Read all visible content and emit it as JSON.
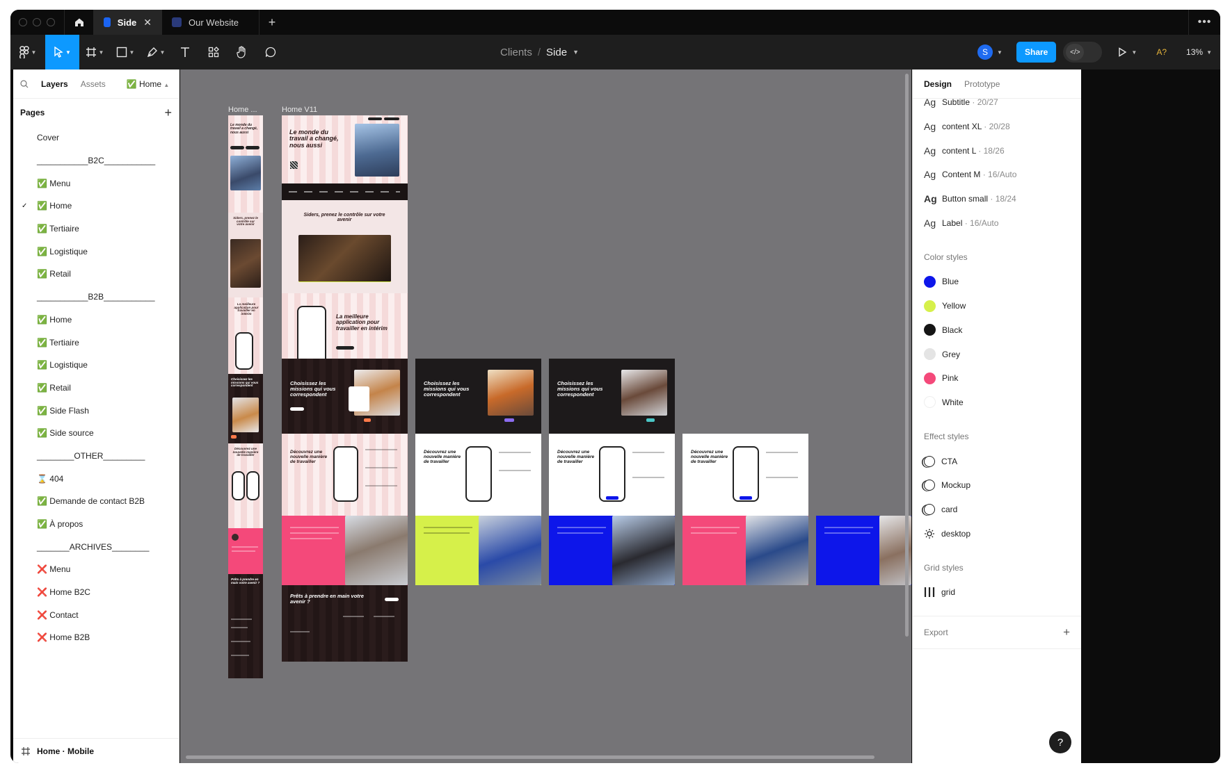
{
  "tabs": {
    "active_label": "Side",
    "inactive_label": "Our Website",
    "close": "✕",
    "new_tab": "+",
    "more": "•••"
  },
  "toolbar": {
    "breadcrumb_project": "Clients",
    "breadcrumb_sep": "/",
    "breadcrumb_file": "Side",
    "avatar_letter": "S",
    "share_label": "Share",
    "devmode_icon": "</>",
    "accessibility_label": "A?",
    "zoom": "13%",
    "icons": [
      "figma-menu-icon",
      "move-icon",
      "frame-icon",
      "shape-icon",
      "pen-icon",
      "text-icon",
      "components-icon",
      "hand-icon",
      "comment-icon",
      "present-icon"
    ]
  },
  "left_panel": {
    "tab_layers": "Layers",
    "tab_assets": "Assets",
    "page_picker": "Home",
    "pages_title": "Pages",
    "add": "+",
    "current_page_check": "✓",
    "pages": [
      "Cover",
      "___________B2C___________",
      "✅ Menu",
      "✅ Home",
      "✅ Tertiaire",
      "✅ Logistique",
      "✅ Retail",
      "___________B2B___________",
      "✅ Home",
      "✅ Tertiaire",
      "✅ Logistique",
      "✅ Retail",
      "✅ Side Flash",
      "✅ Side source",
      "________OTHER_________",
      "⌛ 404",
      "✅ Demande de contact B2B",
      "✅ À propos",
      "_______ARCHIVES________",
      "❌ Menu",
      "❌ Home B2C",
      "❌ Contact",
      "❌ Home B2B"
    ],
    "bottom_layer": "Home · Mobile"
  },
  "canvas": {
    "frame_label_1": "Home ...",
    "frame_label_2": "Home V11",
    "hero_title": "Le monde du travail a changé, nous aussi",
    "siders_title": "Siders, prenez le contrôle sur votre avenir",
    "app_title": "La meilleure application pour travailler en intérim",
    "missions_title": "Choisissez les missions qui vous correspondent",
    "decouvrez_title": "Découvrez une nouvelle manière de travailler",
    "prets_title": "Prêts à prendre en main votre avenir ?",
    "mobile_hero_title": "Le monde du travail a changé, nous aussi",
    "mobile_siders_title": "Siders, prenez le contrôle sur votre avenir",
    "mobile_app_title": "La meilleure application pour travailler en intérim",
    "mobile_missions_title": "Choisissez les missions qui vous correspondent",
    "mobile_decouvrez_title": "Découvrez une nouvelle manière de travailler",
    "mobile_prets_title": "Prêts à prendre en main votre avenir ?"
  },
  "right_panel": {
    "tab_design": "Design",
    "tab_prototype": "Prototype",
    "text_styles": [
      {
        "ag": "Ag",
        "name": "Subtitle",
        "spec": " · 20/27"
      },
      {
        "ag": "Ag",
        "name": "content XL",
        "spec": " · 20/28"
      },
      {
        "ag": "Ag",
        "name": "content L",
        "spec": " · 18/26"
      },
      {
        "ag": "Ag",
        "name": "Content M",
        "spec": " · 16/Auto"
      },
      {
        "ag": "Ag",
        "name": "Button small",
        "spec": " · 18/24"
      },
      {
        "ag": "Ag",
        "name": "Label",
        "spec": " · 16/Auto"
      }
    ],
    "color_styles_title": "Color styles",
    "color_styles": [
      {
        "name": "Blue",
        "color": "#0d16ea"
      },
      {
        "name": "Yellow",
        "color": "#d6f04a"
      },
      {
        "name": "Black",
        "color": "#151515"
      },
      {
        "name": "Grey",
        "color": "#e4e4e4"
      },
      {
        "name": "Pink",
        "color": "#f4497a"
      },
      {
        "name": "White",
        "color": "#ffffff"
      }
    ],
    "effect_styles_title": "Effect styles",
    "effect_styles": [
      "CTA",
      "Mockup",
      "card",
      "desktop"
    ],
    "grid_styles_title": "Grid styles",
    "grid_style": "grid",
    "export_label": "Export",
    "export_add": "+",
    "help": "?"
  }
}
